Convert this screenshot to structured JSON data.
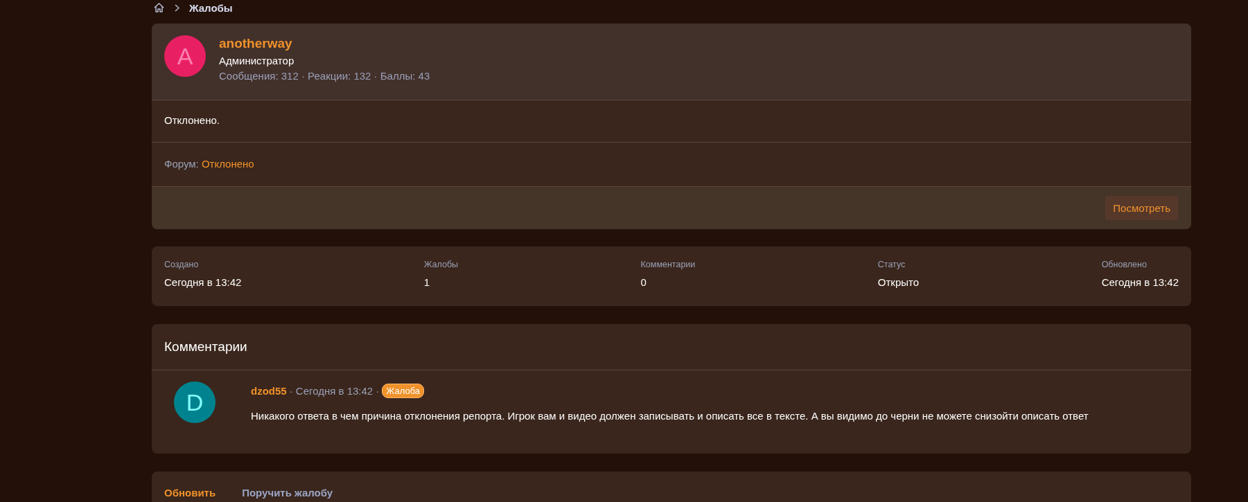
{
  "breadcrumb": {
    "current": "Жалобы"
  },
  "report": {
    "author": {
      "initial": "A",
      "name": "anotherway",
      "role": "Администратор",
      "stats": "Сообщения: 312 · Реакции: 132 · Баллы: 43"
    },
    "message": "Отклонено.",
    "forum_label": "Форум:",
    "forum_link": "Отклонено",
    "view_button": "Посмотреть"
  },
  "stats": [
    {
      "label": "Создано",
      "value": "Сегодня в 13:42"
    },
    {
      "label": "Жалобы",
      "value": "1"
    },
    {
      "label": "Комментарии",
      "value": "0"
    },
    {
      "label": "Статус",
      "value": "Открыто"
    },
    {
      "label": "Обновлено",
      "value": "Сегодня в 13:42"
    }
  ],
  "comments": {
    "title": "Комментарии",
    "items": [
      {
        "initial": "D",
        "author": "dzod55",
        "time": "· Сегодня в 13:42 ·",
        "tag": "Жалоба",
        "text": "Никакого ответа в чем причина отклонения репорта. Игрок вам и видео должен записывать и описать все в тексте. А вы видимо до черни не можете снизойти описать ответ"
      }
    ]
  },
  "actions": [
    {
      "label": "Обновить",
      "kind": "primary"
    },
    {
      "label": "Поручить жалобу",
      "kind": "secondary"
    }
  ]
}
